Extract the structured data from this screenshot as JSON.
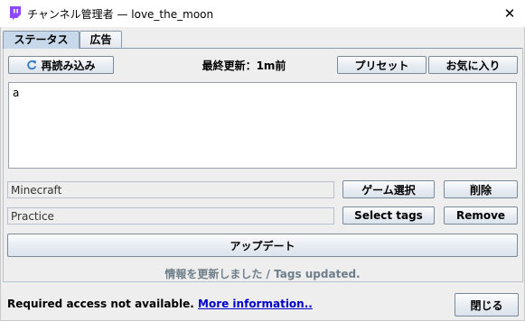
{
  "window": {
    "title": "チャンネル管理者 — love_the_moon",
    "close_glyph": "✕"
  },
  "tabs": [
    {
      "label": "ステータス",
      "selected": true
    },
    {
      "label": "広告",
      "selected": false
    }
  ],
  "toolbar": {
    "reload_label": "再読み込み",
    "reload_icon": "refresh-icon",
    "last_updated": "最終更新：1m前",
    "preset_label": "プリセット",
    "favorites_label": "お気に入り"
  },
  "status_text": "a",
  "game": {
    "value": "Minecraft",
    "select_label": "ゲーム選択",
    "delete_label": "削除"
  },
  "tags": {
    "value": "Practice",
    "select_label": "Select tags",
    "remove_label": "Remove"
  },
  "update_label": "アップデート",
  "status_message": "情報を更新しました / Tags updated.",
  "footer": {
    "notice": "Required access not available.",
    "link": "More information..",
    "close_label": "閉じる"
  },
  "colors": {
    "tab_selected": "#c6d8ea",
    "link": "#0000cc",
    "status_message": "#6f7f89",
    "app_icon": "#9146ff"
  }
}
